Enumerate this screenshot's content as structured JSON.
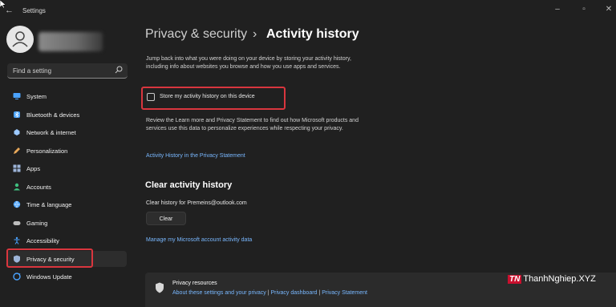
{
  "window": {
    "title": "Settings",
    "controls": [
      "minimize",
      "maximize",
      "close"
    ]
  },
  "user": {
    "avatar_icon": "person-icon"
  },
  "search": {
    "placeholder": "Find a setting"
  },
  "sidebar": {
    "items": [
      {
        "label": "System",
        "icon": "monitor-icon",
        "color": "#4aa3ff"
      },
      {
        "label": "Bluetooth & devices",
        "icon": "bluetooth-icon",
        "color": "#4aa3ff"
      },
      {
        "label": "Network & internet",
        "icon": "wifi-icon",
        "color": "#9cc9ff"
      },
      {
        "label": "Personalization",
        "icon": "pen-icon",
        "color": "#e8a85a"
      },
      {
        "label": "Apps",
        "icon": "apps-icon",
        "color": "#9db4d8"
      },
      {
        "label": "Accounts",
        "icon": "person-icon",
        "color": "#3fbf7f"
      },
      {
        "label": "Time & language",
        "icon": "globe-icon",
        "color": "#4aa3ff"
      },
      {
        "label": "Gaming",
        "icon": "gamepad-icon",
        "color": "#bdbdbd"
      },
      {
        "label": "Accessibility",
        "icon": "accessibility-icon",
        "color": "#4aa3ff"
      },
      {
        "label": "Privacy & security",
        "icon": "shield-icon",
        "color": "#9db4d8",
        "active": true
      },
      {
        "label": "Windows Update",
        "icon": "update-icon",
        "color": "#4aa3ff"
      }
    ]
  },
  "header": {
    "parent": "Privacy & security",
    "separator": "›",
    "title": "Activity history"
  },
  "content": {
    "intro": "Jump back into what you were doing on your device by storing your activity history, including info about websites you browse and how you use apps and services.",
    "store_checkbox": {
      "label": "Store my activity history on this device",
      "checked": false
    },
    "review_text": "Review the Learn more and Privacy Statement to find out how Microsoft products and services use this data to personalize experiences while respecting your privacy.",
    "privacy_link": "Activity History in the Privacy Statement",
    "clear_section": {
      "title": "Clear activity history",
      "history_for": "Clear history for Premeins@outlook.com",
      "button": "Clear"
    },
    "manage_link": "Manage my Microsoft account activity data"
  },
  "resources": {
    "title": "Privacy resources",
    "links": [
      "About these settings and your privacy",
      "Privacy dashboard",
      "Privacy Statement"
    ],
    "link_separator": "|"
  },
  "watermark": {
    "logo": "TN",
    "text": "ThanhNghiep.XYZ"
  },
  "highlight_color": "#d9363e",
  "accent_color": "#79b8ff"
}
